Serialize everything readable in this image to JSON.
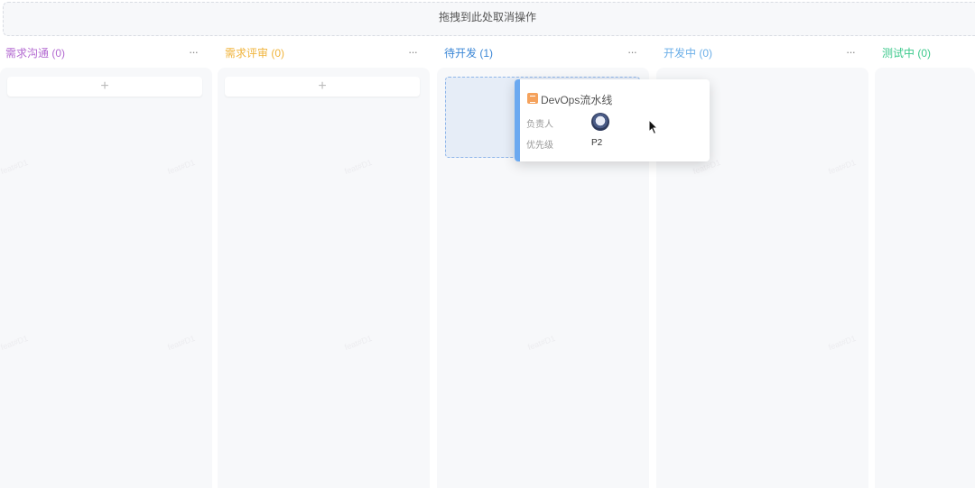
{
  "dropzone": {
    "text": "拖拽到此处取消操作"
  },
  "columns": [
    {
      "title": "需求沟通 (0)",
      "color": "#b36ad1",
      "more": "···",
      "add": "+"
    },
    {
      "title": "需求评审 (0)",
      "color": "#f0b43c",
      "more": "···",
      "add": "+"
    },
    {
      "title": "待开发 (1)",
      "color": "#3a86d6",
      "more": "···"
    },
    {
      "title": "开发中 (0)",
      "color": "#6aaee8",
      "more": "···"
    },
    {
      "title": "测试中 (0)",
      "color": "#3cc98c"
    }
  ],
  "card": {
    "title": "DevOps流水线",
    "assignee_label": "负责人",
    "priority_label": "优先级",
    "priority_value": "P2",
    "bar_color": "#6ba9f0",
    "type_icon": "requirement-icon"
  },
  "watermark": "feat#D1"
}
